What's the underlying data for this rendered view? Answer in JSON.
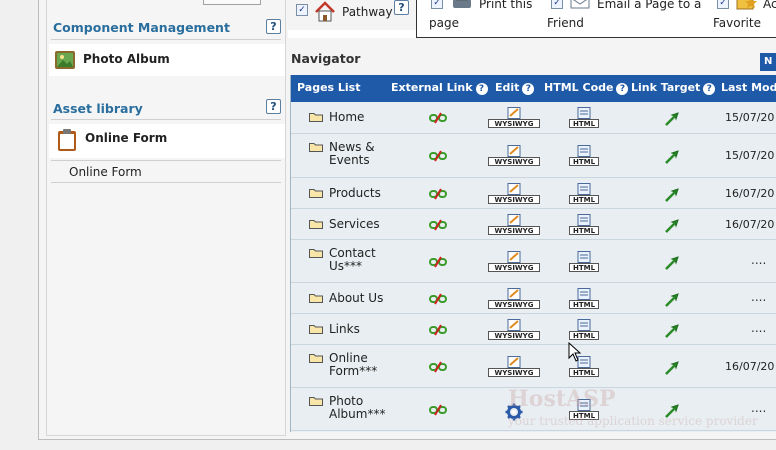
{
  "toolbar": {
    "pathway_label": "Pathway",
    "print_label_1": "Print this",
    "print_label_2": "page",
    "email_label_1": "Email a Page to a",
    "email_label_2": "Friend",
    "favorite_label_1": "Ac",
    "favorite_label_2": "Favorite"
  },
  "sidebar": {
    "component_title": "Component Management",
    "component_item": "Photo Album",
    "asset_title": "Asset library",
    "asset_item": "Online Form",
    "asset_sub_item": "Online Form",
    "help": "?"
  },
  "navigator": {
    "title": "Navigator",
    "button_label": "N",
    "headers": {
      "pages": "Pages List",
      "external": "External Link",
      "edit": "Edit",
      "html": "HTML Code",
      "target": "Link Target",
      "modified": "Last Modi"
    },
    "help": "?",
    "rows": [
      {
        "name1": "Home",
        "name2": "",
        "date": "15/07/20",
        "dots": ""
      },
      {
        "name1": "News &",
        "name2": "Events",
        "date": "15/07/20",
        "dots": ""
      },
      {
        "name1": "Products",
        "name2": "",
        "date": "16/07/20",
        "dots": ""
      },
      {
        "name1": "Services",
        "name2": "",
        "date": "16/07/20",
        "dots": ""
      },
      {
        "name1": "Contact",
        "name2": "Us***",
        "date": "",
        "dots": "...."
      },
      {
        "name1": "About Us",
        "name2": "",
        "date": "",
        "dots": "...."
      },
      {
        "name1": "Links",
        "name2": "",
        "date": "",
        "dots": "...."
      },
      {
        "name1": "Online",
        "name2": "Form***",
        "date": "16/07/20",
        "dots": ""
      },
      {
        "name1": "Photo",
        "name2": "Album***",
        "date": "",
        "dots": "...."
      }
    ],
    "wysiwyg_label": "WYSIWYG",
    "html_label": "HTML"
  },
  "watermark": {
    "brand": "HostASP",
    "tagline": "your trusted application service provider"
  },
  "colors": {
    "header_blue": "#1e5aa8",
    "section_title": "#2a6e9e",
    "grid_bg": "#e8eef1"
  }
}
